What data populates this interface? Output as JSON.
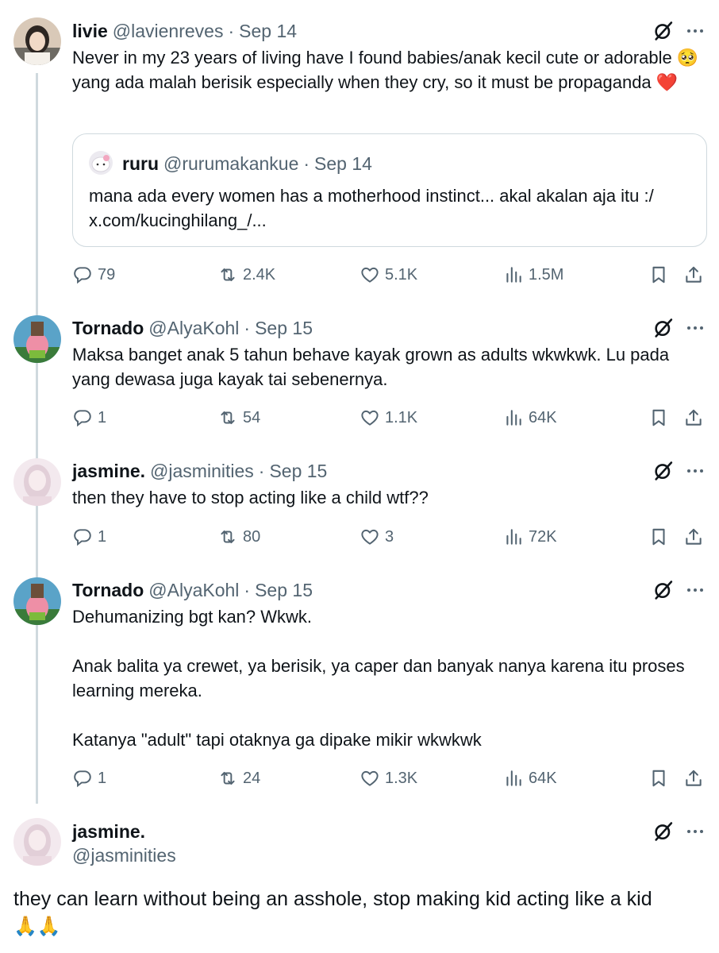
{
  "tweets": [
    {
      "name": "livie",
      "handle": "@lavienreves",
      "sep": "·",
      "date": "Sep 14",
      "text": "Never in my 23 years of living have I found babies/anak kecil cute or adorable 🥺 yang ada malah berisik especially when they cry, so it must be propaganda ❤️",
      "quote": {
        "name": "ruru",
        "handle": "@rurumakankue",
        "sep": "·",
        "date": "Sep 14",
        "text": "mana ada every women has a motherhood instinct... akal akalan aja itu :/ x.com/kucinghilang_/..."
      },
      "stats": {
        "replies": "79",
        "reposts": "2.4K",
        "likes": "5.1K",
        "views": "1.5M"
      }
    },
    {
      "name": "Tornado",
      "handle": "@AlyaKohl",
      "sep": "·",
      "date": "Sep 15",
      "text": "Maksa banget anak 5 tahun behave kayak grown as adults wkwkwk. Lu pada yang dewasa juga kayak tai sebenernya.",
      "stats": {
        "replies": "1",
        "reposts": "54",
        "likes": "1.1K",
        "views": "64K"
      }
    },
    {
      "name": "jasmine.",
      "handle": "@jasminities",
      "sep": "·",
      "date": "Sep 15",
      "text": "then they have to stop acting like a child wtf??",
      "stats": {
        "replies": "1",
        "reposts": "80",
        "likes": "3",
        "views": "72K"
      }
    },
    {
      "name": "Tornado",
      "handle": "@AlyaKohl",
      "sep": "·",
      "date": "Sep 15",
      "text": "Dehumanizing bgt kan? Wkwk.\n\nAnak balita ya crewet, ya berisik, ya caper dan banyak nanya karena itu proses learning mereka.\n\nKatanya \"adult\" tapi otaknya ga dipake mikir wkwkwk",
      "stats": {
        "replies": "1",
        "reposts": "24",
        "likes": "1.3K",
        "views": "64K"
      }
    }
  ],
  "main_tweet": {
    "name": "jasmine.",
    "handle": "@jasminities",
    "text": "they can learn without being an asshole, stop making kid acting like a kid",
    "emoji": "🙏🙏"
  },
  "icons": {
    "reply": "reply-bubble-icon",
    "repost": "repost-icon",
    "like": "heart-icon",
    "views": "views-chart-icon",
    "bookmark": "bookmark-icon",
    "share": "share-icon",
    "grok": "grok-icon",
    "more": "more-dots-icon"
  },
  "colors": {
    "text": "#0f1419",
    "muted": "#536471",
    "border": "#cfd9de",
    "background": "#ffffff"
  }
}
